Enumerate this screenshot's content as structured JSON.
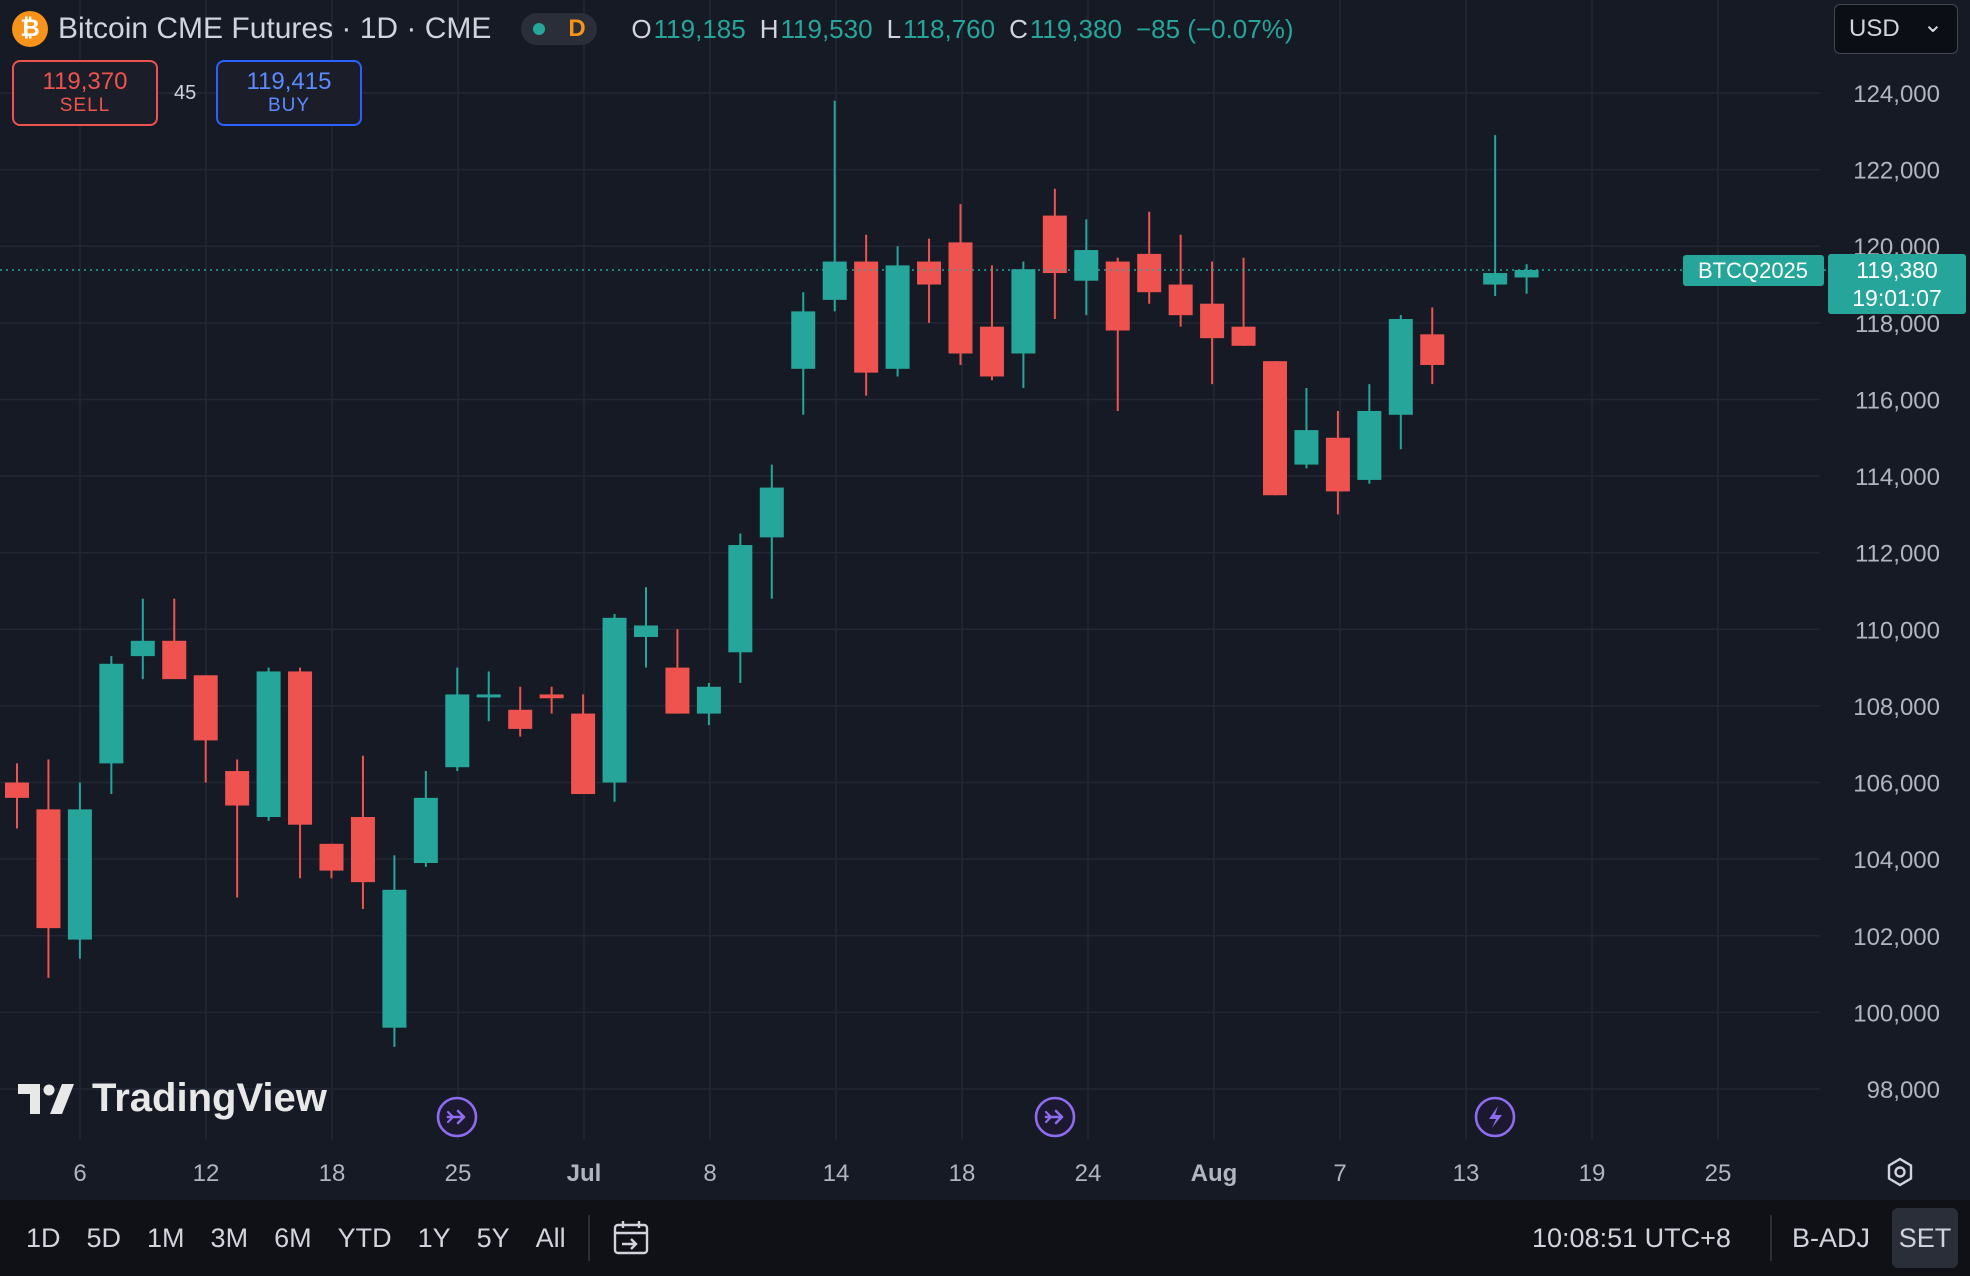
{
  "header": {
    "coin_glyph": "₿",
    "title": "Bitcoin CME Futures · 1D · CME",
    "flag_letter": "D",
    "ohlc": [
      {
        "k": "O",
        "v": "119,185"
      },
      {
        "k": "H",
        "v": "119,530"
      },
      {
        "k": "L",
        "v": "118,760"
      },
      {
        "k": "C",
        "v": "119,380"
      }
    ],
    "change": "−85 (−0.07%)",
    "currency": "USD",
    "currency_chevron": "⌄"
  },
  "trade": {
    "sell_price": "119,370",
    "sell_label": "SELL",
    "spread": "45",
    "buy_price": "119,415",
    "buy_label": "BUY"
  },
  "price_tag": {
    "symbol": "BTCQ2025",
    "price": "119,380",
    "countdown": "19:01:07"
  },
  "logo_text": "TradingView",
  "bottom": {
    "ranges": [
      "1D",
      "5D",
      "1M",
      "3M",
      "6M",
      "YTD",
      "1Y",
      "5Y",
      "All"
    ],
    "time": "10:08:51 UTC+8",
    "badj": "B-ADJ",
    "set": "SET"
  },
  "colors": {
    "up": "#26a69a",
    "down": "#ef5350",
    "background": "#161a25",
    "grid": "#232735",
    "event": "#8e6cef"
  },
  "chart_data": {
    "type": "candlestick",
    "x_tick_labels": [
      "6",
      "12",
      "18",
      "25",
      "Jul",
      "8",
      "14",
      "18",
      "24",
      "Aug",
      "7",
      "13",
      "19",
      "25"
    ],
    "y_ticks": [
      98000,
      100000,
      102000,
      104000,
      106000,
      108000,
      110000,
      112000,
      114000,
      116000,
      118000,
      120000,
      122000,
      124000
    ],
    "ylim": [
      97000,
      125500
    ],
    "last_price": 119380,
    "grid": true,
    "event_markers": [
      {
        "type": "split",
        "icon": "arrow-circle-icon",
        "near_label": "25"
      },
      {
        "type": "split",
        "icon": "arrow-circle-icon",
        "near_label": "24"
      },
      {
        "type": "flash",
        "icon": "lightning-icon",
        "near_label": "13"
      }
    ],
    "candles": [
      {
        "o": 106000,
        "h": 106500,
        "l": 104800,
        "c": 105600
      },
      {
        "o": 105300,
        "h": 106600,
        "l": 100900,
        "c": 102200
      },
      {
        "o": 101900,
        "h": 106000,
        "l": 101400,
        "c": 105300
      },
      {
        "o": 106500,
        "h": 109300,
        "l": 105700,
        "c": 109100
      },
      {
        "o": 109300,
        "h": 110800,
        "l": 108700,
        "c": 109700
      },
      {
        "o": 109700,
        "h": 110800,
        "l": 108800,
        "c": 108700
      },
      {
        "o": 108800,
        "h": 108800,
        "l": 106000,
        "c": 107100
      },
      {
        "o": 106300,
        "h": 106600,
        "l": 103000,
        "c": 105400
      },
      {
        "o": 105100,
        "h": 109000,
        "l": 105000,
        "c": 108900
      },
      {
        "o": 108900,
        "h": 109000,
        "l": 103500,
        "c": 104900
      },
      {
        "o": 104400,
        "h": 104400,
        "l": 103500,
        "c": 103700
      },
      {
        "o": 105100,
        "h": 106700,
        "l": 102700,
        "c": 103400
      },
      {
        "o": 99600,
        "h": 104100,
        "l": 99100,
        "c": 103200
      },
      {
        "o": 103900,
        "h": 106300,
        "l": 103800,
        "c": 105600
      },
      {
        "o": 106400,
        "h": 109000,
        "l": 106300,
        "c": 108300
      },
      {
        "o": 108300,
        "h": 108900,
        "l": 107600,
        "c": 108300
      },
      {
        "o": 107900,
        "h": 108500,
        "l": 107200,
        "c": 107400
      },
      {
        "o": 108300,
        "h": 108500,
        "l": 107800,
        "c": 108200
      },
      {
        "o": 107800,
        "h": 108300,
        "l": 105800,
        "c": 105700
      },
      {
        "o": 106000,
        "h": 110400,
        "l": 105500,
        "c": 110300
      },
      {
        "o": 109800,
        "h": 111100,
        "l": 109000,
        "c": 110100
      },
      {
        "o": 109000,
        "h": 110000,
        "l": 107800,
        "c": 107800
      },
      {
        "o": 107800,
        "h": 108600,
        "l": 107500,
        "c": 108500
      },
      {
        "o": 109400,
        "h": 112500,
        "l": 108600,
        "c": 112200
      },
      {
        "o": 112400,
        "h": 114300,
        "l": 110800,
        "c": 113700
      },
      {
        "o": 116800,
        "h": 118800,
        "l": 115600,
        "c": 118300
      },
      {
        "o": 118600,
        "h": 123800,
        "l": 118300,
        "c": 119600
      },
      {
        "o": 119600,
        "h": 120300,
        "l": 116100,
        "c": 116700
      },
      {
        "o": 116800,
        "h": 120000,
        "l": 116600,
        "c": 119500
      },
      {
        "o": 119600,
        "h": 120200,
        "l": 118000,
        "c": 119000
      },
      {
        "o": 120100,
        "h": 121100,
        "l": 116900,
        "c": 117200
      },
      {
        "o": 117900,
        "h": 119500,
        "l": 116500,
        "c": 116600
      },
      {
        "o": 117200,
        "h": 119600,
        "l": 116300,
        "c": 119400
      },
      {
        "o": 120800,
        "h": 121500,
        "l": 118100,
        "c": 119300
      },
      {
        "o": 119100,
        "h": 120700,
        "l": 118200,
        "c": 119900
      },
      {
        "o": 119600,
        "h": 119700,
        "l": 115700,
        "c": 117800
      },
      {
        "o": 119800,
        "h": 120900,
        "l": 118500,
        "c": 118800
      },
      {
        "o": 119000,
        "h": 120300,
        "l": 117900,
        "c": 118200
      },
      {
        "o": 118500,
        "h": 119600,
        "l": 116400,
        "c": 117600
      },
      {
        "o": 117900,
        "h": 119700,
        "l": 117400,
        "c": 117400
      },
      {
        "o": 117000,
        "h": 117000,
        "l": 113500,
        "c": 113500
      },
      {
        "o": 114300,
        "h": 116300,
        "l": 114200,
        "c": 115200
      },
      {
        "o": 115000,
        "h": 115700,
        "l": 113000,
        "c": 113600
      },
      {
        "o": 113900,
        "h": 116400,
        "l": 113800,
        "c": 115700
      },
      {
        "o": 115600,
        "h": 118200,
        "l": 114700,
        "c": 118100
      },
      {
        "o": 117700,
        "h": 118400,
        "l": 116400,
        "c": 116900
      },
      {
        "o": null,
        "h": null,
        "l": null,
        "c": null
      },
      {
        "o": 119000,
        "h": 122900,
        "l": 118700,
        "c": 119300
      },
      {
        "o": 119185,
        "h": 119530,
        "l": 118760,
        "c": 119380
      }
    ]
  }
}
